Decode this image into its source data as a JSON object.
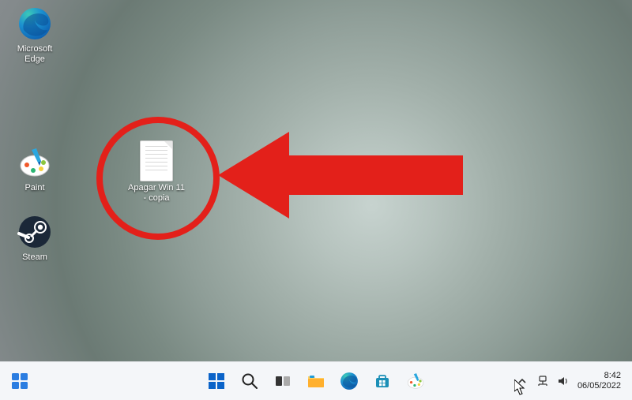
{
  "desktop": {
    "icons": {
      "edge": {
        "label": "Microsoft Edge",
        "icon": "edge-icon"
      },
      "paint": {
        "label": "Paint",
        "icon": "paint-icon"
      },
      "steam": {
        "label": "Steam",
        "icon": "steam-icon"
      },
      "file": {
        "label": "Apagar Win 11 - copia",
        "icon": "text-file-icon"
      }
    }
  },
  "annotation": {
    "circle_color": "#e3201a",
    "arrow_color": "#e3201a"
  },
  "taskbar": {
    "widgets_icon": "widgets-icon",
    "pinned": [
      {
        "name": "start-icon"
      },
      {
        "name": "search-icon"
      },
      {
        "name": "task-view-icon"
      },
      {
        "name": "file-explorer-icon"
      },
      {
        "name": "edge-icon"
      },
      {
        "name": "microsoft-store-icon"
      },
      {
        "name": "paint-icon"
      }
    ],
    "tray": {
      "chevron": "chevron-up-icon",
      "network": "network-icon",
      "volume": "volume-icon"
    },
    "clock": {
      "time": "8:42",
      "date": "06/05/2022"
    }
  }
}
